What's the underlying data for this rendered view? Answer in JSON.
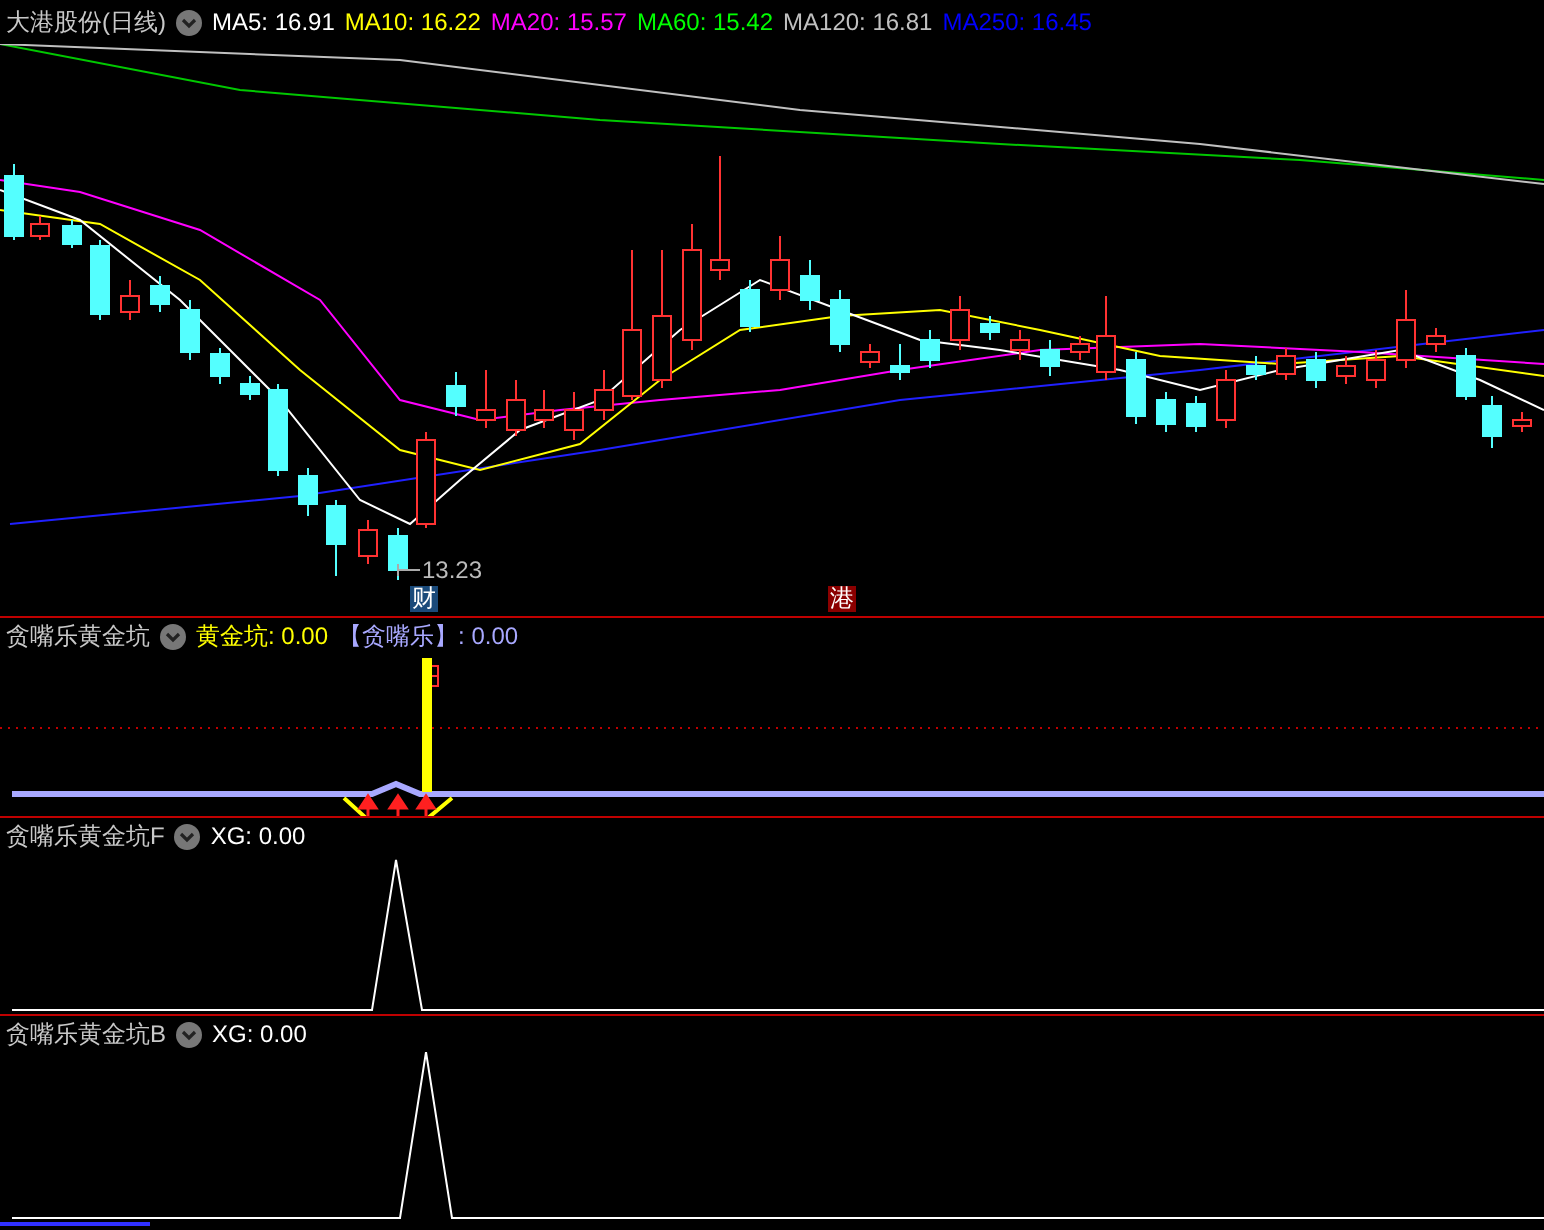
{
  "main_panel": {
    "title": "大港股份(日线)",
    "indicators": [
      {
        "label": "MA5: 16.91",
        "color": "#ffffff"
      },
      {
        "label": "MA10: 16.22",
        "color": "#ffff00"
      },
      {
        "label": "MA20: 15.57",
        "color": "#ff00ff"
      },
      {
        "label": "MA60: 15.42",
        "color": "#00ff00"
      },
      {
        "label": "MA120: 16.81",
        "color": "#c0c0c0"
      },
      {
        "label": "MA250: 16.45",
        "color": "#0000ff"
      }
    ],
    "low_marker": "13.23",
    "event_tags": [
      {
        "text": "财",
        "color": "#1a4a7a"
      },
      {
        "text": "港",
        "color": "#8b0000"
      }
    ]
  },
  "panels": [
    {
      "title": "贪嘴乐黄金坑",
      "indicators": [
        {
          "label": "黄金坑: 0.00",
          "color": "#ffff00"
        },
        {
          "label": "【贪嘴乐】: 0.00",
          "color": "#a8a8ff"
        }
      ]
    },
    {
      "title": "贪嘴乐黄金坑F",
      "indicators": [
        {
          "label": "XG: 0.00",
          "color": "#ffffff"
        }
      ]
    },
    {
      "title": "贪嘴乐黄金坑B",
      "indicators": [
        {
          "label": "XG: 0.00",
          "color": "#ffffff"
        }
      ]
    }
  ]
}
